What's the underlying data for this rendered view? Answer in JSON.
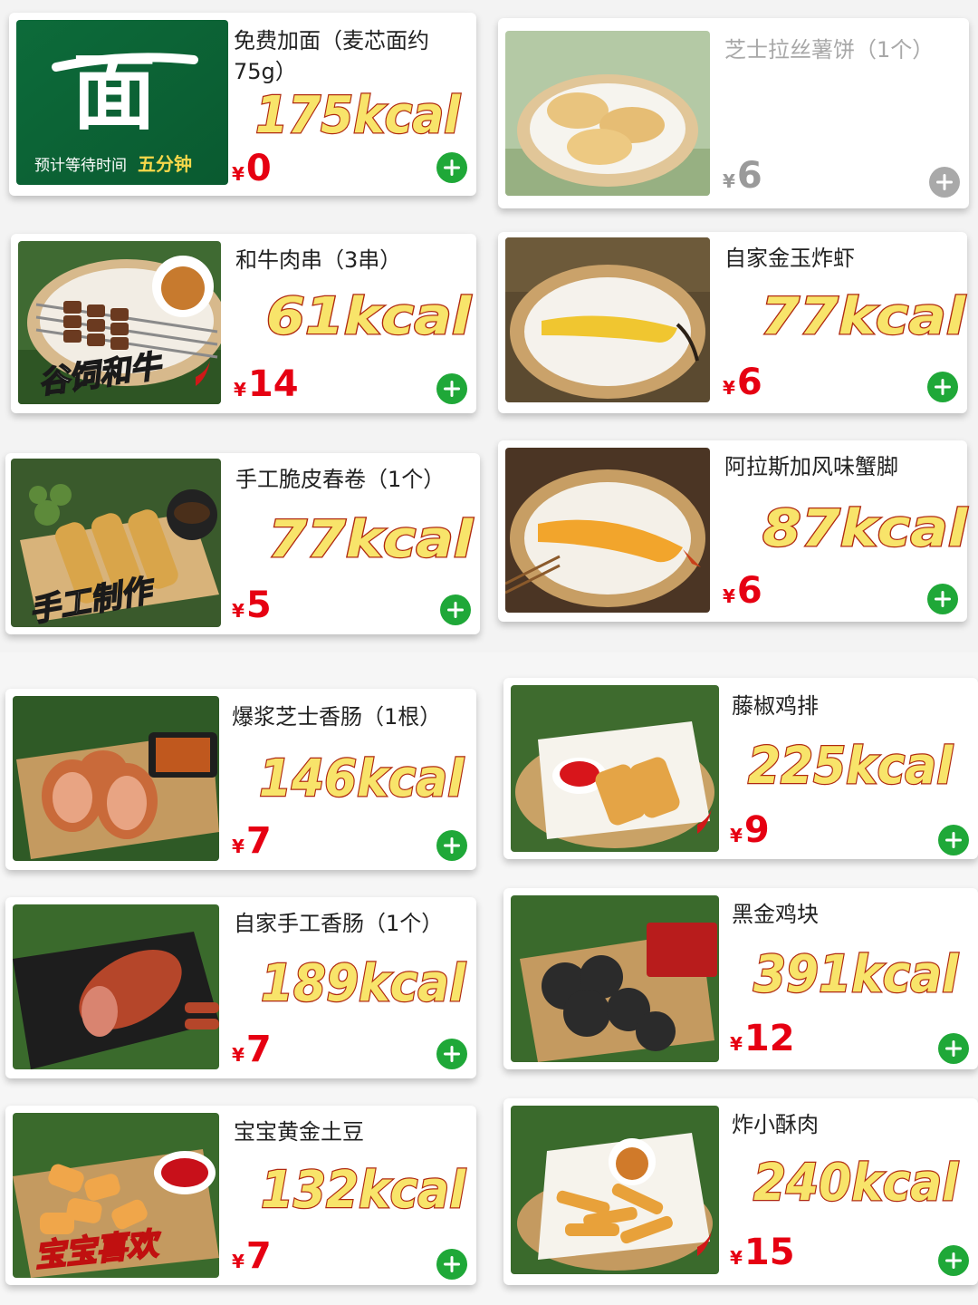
{
  "currency_symbol": "¥",
  "colors": {
    "price_red": "#e60012",
    "add_green": "#1fa838",
    "add_disabled": "#a9a9a9",
    "kcal_fill": "#f8e46a",
    "kcal_outline": "#b02a10"
  },
  "items": [
    {
      "name": "免费加面（麦芯面约75g）",
      "kcal": "175kcal",
      "price": "0",
      "image": "noodle-logo-image",
      "badge": "面",
      "badge_sub": "预计等待时间",
      "badge_em": "五分钟",
      "disabled": false
    },
    {
      "name": "芝士拉丝薯饼（1个）",
      "kcal": "",
      "price": "6",
      "image": "potato-cake-image",
      "disabled": true
    },
    {
      "name": "和牛肉串（3串）",
      "kcal": "61kcal",
      "price": "14",
      "image": "wagyu-skewer-image",
      "overlay": "谷饲和牛",
      "disabled": false
    },
    {
      "name": "自家金玉炸虾",
      "kcal": "77kcal",
      "price": "6",
      "image": "fried-shrimp-image",
      "disabled": false
    },
    {
      "name": "手工脆皮春卷（1个）",
      "kcal": "77kcal",
      "price": "5",
      "image": "spring-roll-image",
      "overlay": "手工制作",
      "disabled": false
    },
    {
      "name": "阿拉斯加风味蟹脚",
      "kcal": "87kcal",
      "price": "6",
      "image": "crab-leg-image",
      "disabled": false
    },
    {
      "name": "爆浆芝士香肠（1根）",
      "kcal": "146kcal",
      "price": "7",
      "image": "cheese-sausage-image",
      "disabled": false
    },
    {
      "name": "藤椒鸡排",
      "kcal": "225kcal",
      "price": "9",
      "image": "chicken-cutlet-image",
      "disabled": false
    },
    {
      "name": "自家手工香肠（1个）",
      "kcal": "189kcal",
      "price": "7",
      "image": "homemade-sausage-image",
      "disabled": false
    },
    {
      "name": "黑金鸡块",
      "kcal": "391kcal",
      "price": "12",
      "image": "black-nugget-image",
      "disabled": false
    },
    {
      "name": "宝宝黄金土豆",
      "kcal": "132kcal",
      "price": "7",
      "image": "golden-potato-image",
      "overlay": "宝宝喜欢",
      "disabled": false
    },
    {
      "name": "炸小酥肉",
      "kcal": "240kcal",
      "price": "15",
      "image": "crispy-pork-image",
      "disabled": false
    }
  ]
}
